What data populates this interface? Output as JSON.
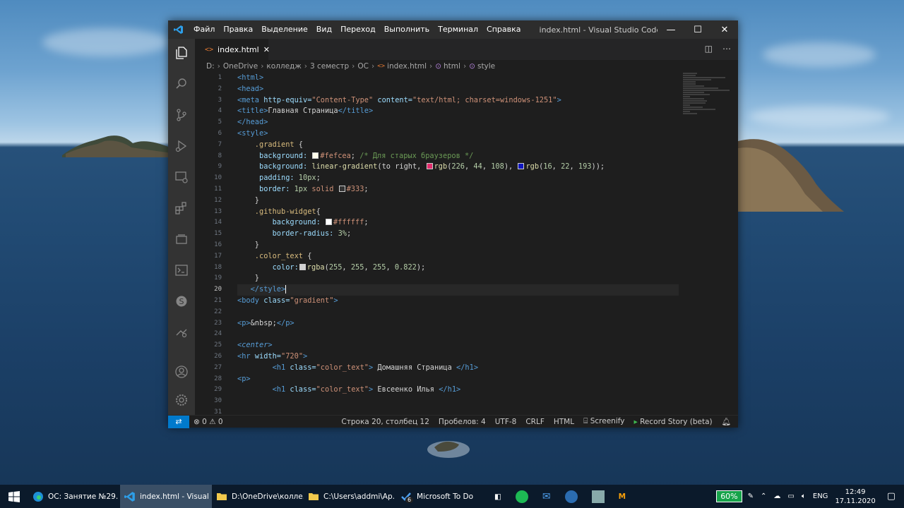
{
  "window": {
    "menu": [
      "Файл",
      "Правка",
      "Выделение",
      "Вид",
      "Переход",
      "Выполнить",
      "Терминал",
      "Справка"
    ],
    "title": "index.html - Visual Studio Code [Администрат...",
    "min": "—",
    "max": "☐",
    "close": "✕"
  },
  "tab": {
    "icon": "<>",
    "label": "index.html",
    "close": "✕"
  },
  "tab_actions": {
    "split": "◫",
    "more": "⋯"
  },
  "breadcrumb": {
    "items": [
      "D:",
      "OneDrive",
      "колледж",
      "3 семестр",
      "ОС",
      "index.html",
      "html",
      "style"
    ]
  },
  "editor": {
    "line_numbers": [
      "1",
      "2",
      "3",
      "4",
      "5",
      "6",
      "7",
      "8",
      "9",
      "10",
      "11",
      "12",
      "13",
      "14",
      "15",
      "16",
      "17",
      "18",
      "19",
      "20",
      "21",
      "22",
      "23",
      "24",
      "25",
      "26",
      "27",
      "28",
      "29",
      "30",
      "31"
    ],
    "cursor_line": 20,
    "colors": {
      "fefcea": "#fefcea",
      "c1": "#e22c6c",
      "c2": "#1016c1",
      "c333": "#333333",
      "fff": "#ffffff",
      "rgba": "#d1d1d1"
    }
  },
  "code": {
    "l1a": "<html>",
    "l2a": "<head>",
    "l3a": "<meta",
    "l3b": " http-equiv=",
    "l3c": "\"Content-Type\"",
    "l3d": " content=",
    "l3e": "\"text/html; charset=windows-1251\"",
    "l3f": ">",
    "l4a": "<title>",
    "l4b": "Главная Страница",
    "l4c": "</title>",
    "l5a": "</head>",
    "l6a": "<style>",
    "l7a": "    .gradient",
    "l7b": " {",
    "l8a": "     background: ",
    "l8b": "#fefcea",
    "l8c": "; ",
    "l8d": "/* Для старых браузеров */",
    "l9a": "     background: ",
    "l9b": "linear-gradient",
    "l9c": "(to right, ",
    "l9d": "rgb",
    "l9e": "(",
    "l9f": "226",
    "l9g": ", ",
    "l9h": "44",
    "l9i": ", ",
    "l9j": "108",
    "l9k": "), ",
    "l9l": "rgb",
    "l9m": "(",
    "l9n": "16",
    "l9o": ", ",
    "l9p": "22",
    "l9q": ", ",
    "l9r": "193",
    "l9s": "));",
    "l10a": "     padding: ",
    "l10b": "10px",
    "l10c": ";",
    "l11a": "     border: ",
    "l11b": "1px",
    "l11c": " solid ",
    "l11d": "#333",
    "l11e": ";",
    "l12a": "    }",
    "l13a": "    .github-widget",
    "l13b": "{",
    "l14a": "        background: ",
    "l14b": "#ffffff",
    "l14c": ";",
    "l15a": "        border-radius: ",
    "l15b": "3%",
    "l15c": ";",
    "l16a": "    }",
    "l17a": "    .color_text",
    "l17b": " {",
    "l18a": "        color:",
    "l18b": "rgba",
    "l18c": "(",
    "l18d": "255",
    "l18e": ", ",
    "l18f": "255",
    "l18g": ", ",
    "l18h": "255",
    "l18i": ", ",
    "l18j": "0.822",
    "l18k": ");",
    "l19a": "    }",
    "l20a": "   </style>",
    "l21a": "<body",
    "l21b": " class=",
    "l21c": "\"gradient\"",
    "l21d": ">",
    "l23a": "<p>",
    "l23b": "&nbsp;",
    "l23c": "</p>",
    "l25a": "<center>",
    "l26a": "<hr",
    "l26b": " width=",
    "l26c": "\"720\"",
    "l26d": ">",
    "l27a": "        <h1",
    "l27b": " class=",
    "l27c": "\"color_text\"",
    "l27d": ">",
    "l27e": " Домашняя Страница ",
    "l27f": "</h1>",
    "l28a": "<p>",
    "l29a": "        <h1",
    "l29b": " class=",
    "l29c": "\"color_text\"",
    "l29d": ">",
    "l29e": " Евсеенко Илья ",
    "l29f": "</h1>"
  },
  "status": {
    "remote": "⇄",
    "problems": "⊗ 0 ⚠ 0",
    "position": "Строка 20, столбец 12",
    "spaces": "Пробелов: 4",
    "encoding": "UTF-8",
    "eol": "CRLF",
    "language": "HTML",
    "screenify": "Screenify",
    "record": "Record Story (beta)"
  },
  "taskbar": {
    "items": [
      {
        "label": "ОС: Занятие №29. ...",
        "icon": "edge-icon"
      },
      {
        "label": "index.html - Visual ...",
        "icon": "vscode-icon"
      },
      {
        "label": "D:\\OneDrive\\колле...",
        "icon": "folder-icon"
      },
      {
        "label": "C:\\Users\\addmi\\Ap...",
        "icon": "folder-icon"
      },
      {
        "label": "Microsoft To Do",
        "icon": "todo-icon",
        "badge": "6"
      }
    ],
    "battery": "60%",
    "lang": "ENG",
    "time": "12:49",
    "date": "17.11.2020"
  }
}
